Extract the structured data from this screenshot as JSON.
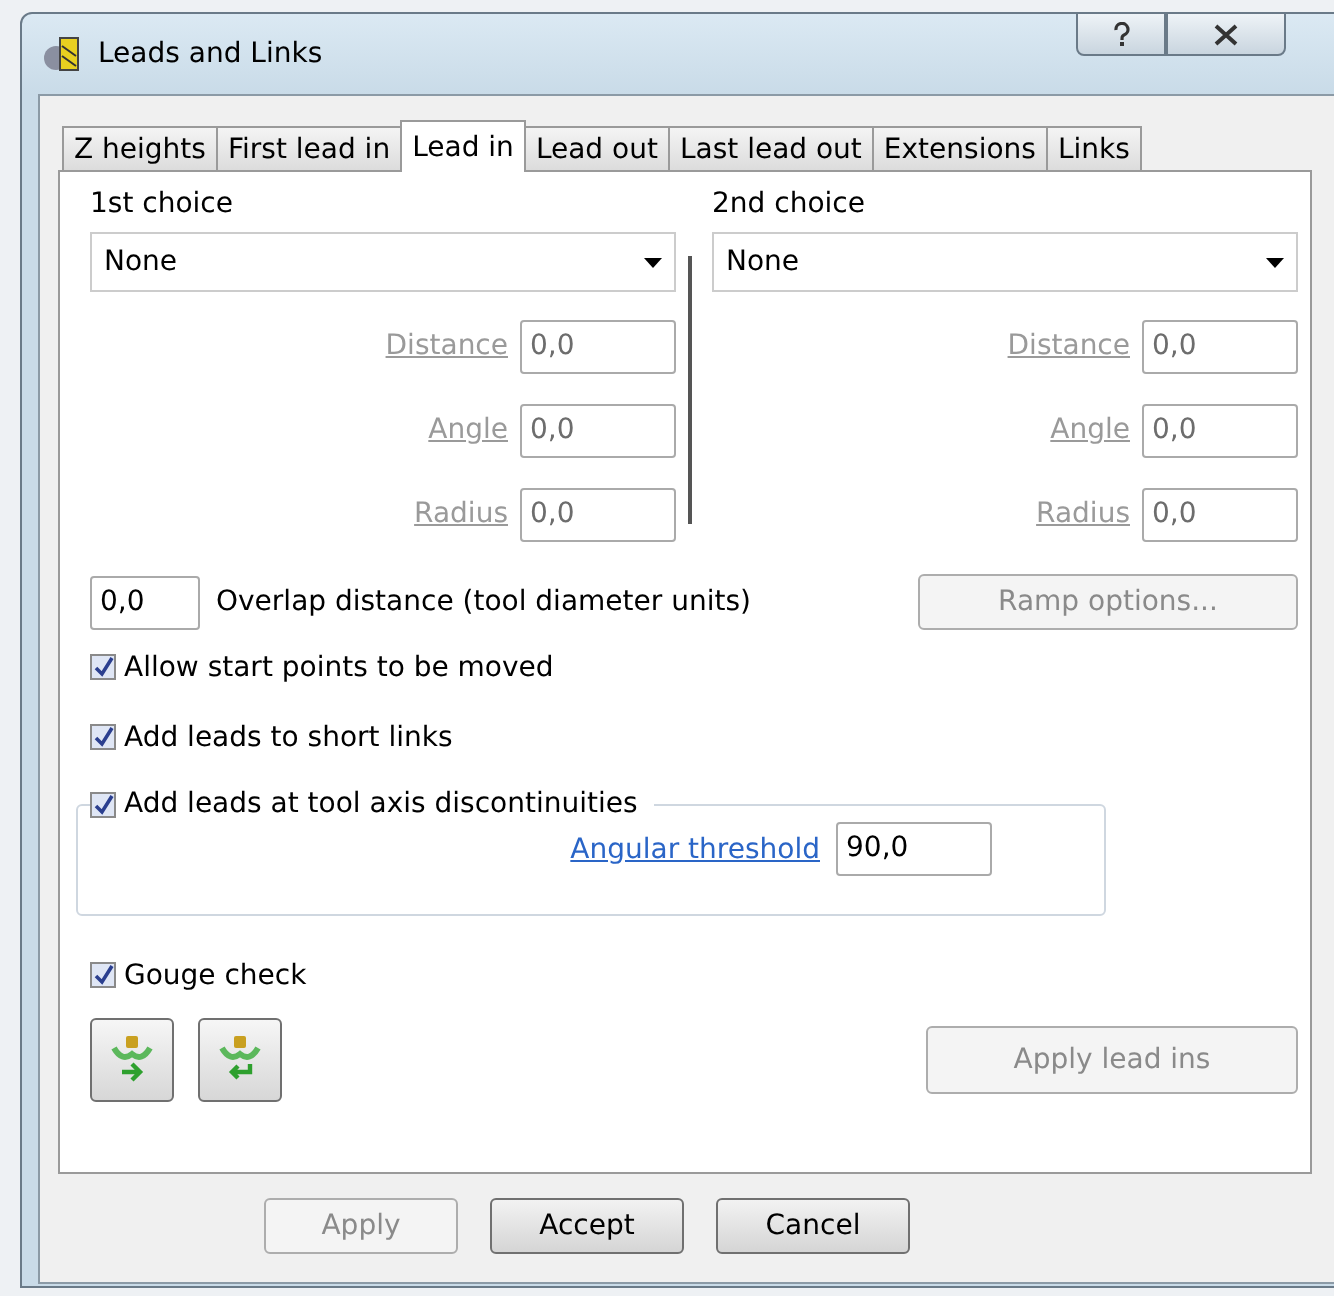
{
  "window": {
    "title": "Leads and Links"
  },
  "tabs": [
    {
      "label": "Z heights",
      "selected": false
    },
    {
      "label": "First lead in",
      "selected": false
    },
    {
      "label": "Lead in",
      "selected": true
    },
    {
      "label": "Lead out",
      "selected": false
    },
    {
      "label": "Last lead out",
      "selected": false
    },
    {
      "label": "Extensions",
      "selected": false
    },
    {
      "label": "Links",
      "selected": false
    }
  ],
  "choices": [
    {
      "heading": "1st choice",
      "value": "None",
      "fields": [
        {
          "label": "Distance",
          "value": "0,0",
          "disabled": true
        },
        {
          "label": "Angle",
          "value": "0,0",
          "disabled": true
        },
        {
          "label": "Radius",
          "value": "0,0",
          "disabled": true
        }
      ]
    },
    {
      "heading": "2nd choice",
      "value": "None",
      "fields": [
        {
          "label": "Distance",
          "value": "0,0",
          "disabled": true
        },
        {
          "label": "Angle",
          "value": "0,0",
          "disabled": true
        },
        {
          "label": "Radius",
          "value": "0,0",
          "disabled": true
        }
      ]
    }
  ],
  "overlap": {
    "value": "0,0",
    "label": "Overlap distance (tool diameter units)"
  },
  "ramp_button": {
    "label": "Ramp options...",
    "disabled": true
  },
  "options": [
    {
      "label": "Allow start points to be moved",
      "checked": true
    },
    {
      "label": "Add leads to short links",
      "checked": true
    }
  ],
  "axis_group": {
    "label": "Add leads at tool axis discontinuities",
    "checked": true,
    "link": "Angular threshold",
    "value": "90,0"
  },
  "gouge": {
    "label": "Gouge check",
    "checked": true
  },
  "tool_buttons": [
    {
      "kind": "forward"
    },
    {
      "kind": "back"
    }
  ],
  "apply_lead_ins": {
    "label": "Apply lead ins",
    "disabled": true
  },
  "buttons": [
    {
      "label": "Apply",
      "disabled": true
    },
    {
      "label": "Accept",
      "disabled": false
    },
    {
      "label": "Cancel",
      "disabled": false
    }
  ]
}
